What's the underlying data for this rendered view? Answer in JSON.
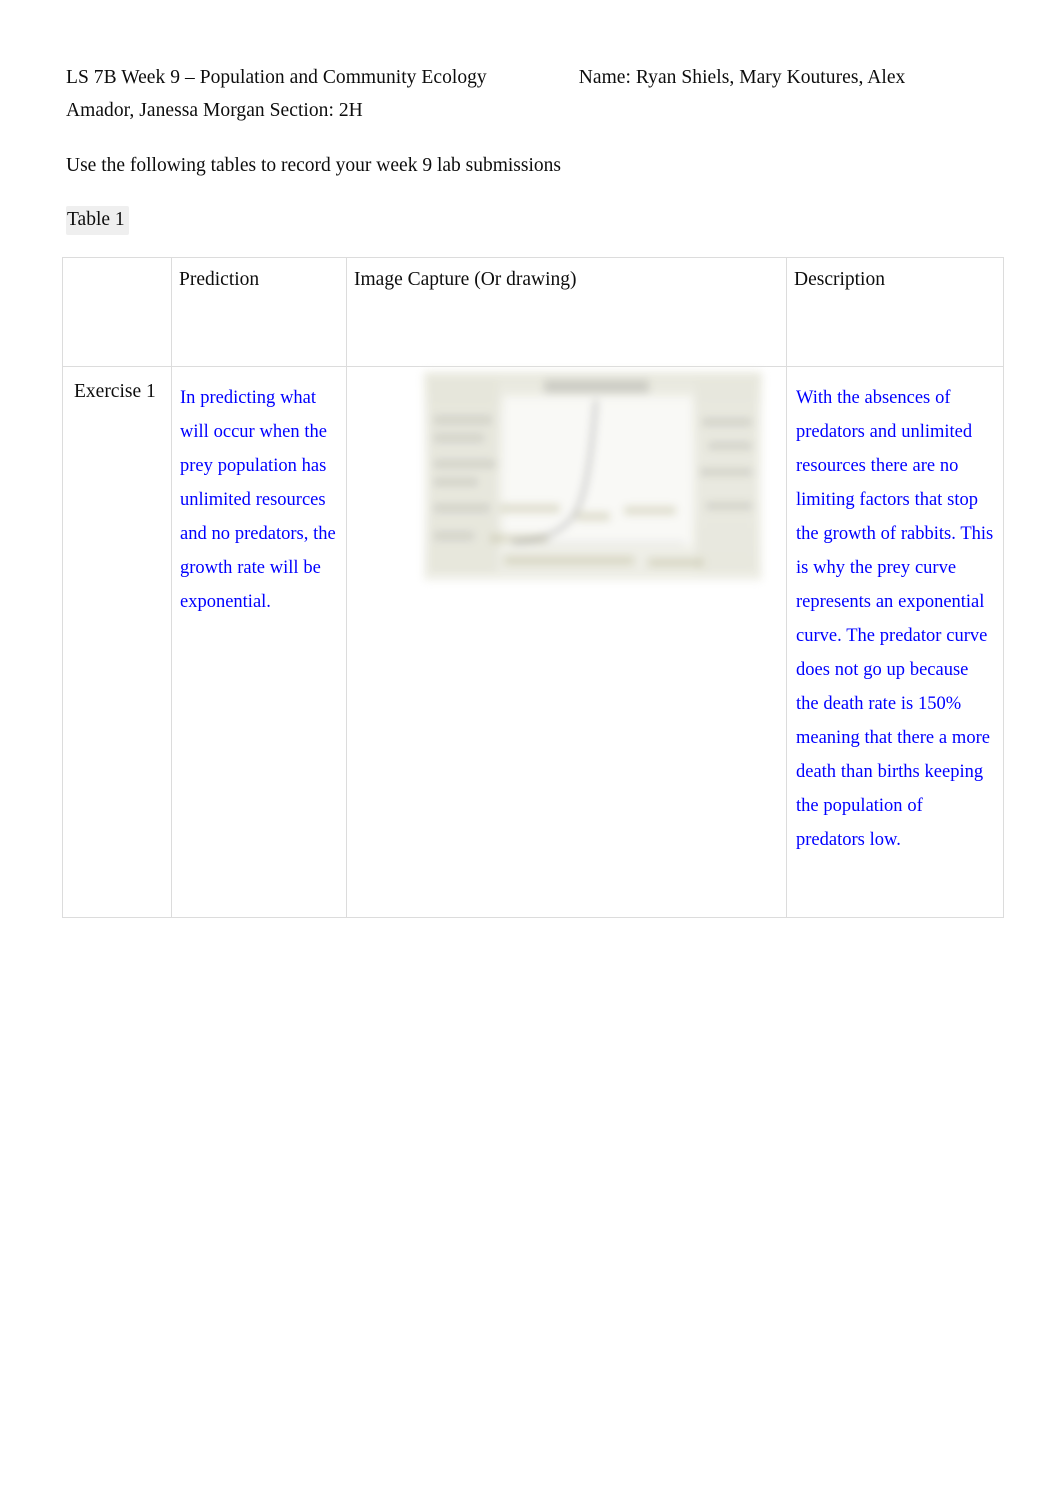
{
  "document": {
    "header": {
      "course_line": "LS 7B Week 9 – Population and Community Ecology",
      "name_line": "Name: Ryan Shiels, Mary Koutures, Alex",
      "second_line": "Amador, Janessa Morgan Section: 2H"
    },
    "instruction": "Use the following tables to record your week 9 lab submissions",
    "table_label": "Table 1"
  },
  "table": {
    "columns": [
      {
        "key": "row_label",
        "header": ""
      },
      {
        "key": "prediction",
        "header": "Prediction"
      },
      {
        "key": "image_capture",
        "header": "Image Capture (Or drawing)"
      },
      {
        "key": "description",
        "header": "Description"
      }
    ],
    "rows": [
      {
        "row_label": "Exercise 1",
        "prediction": "In predicting what will occur when the prey population has unlimited resources and no predators, the growth rate will be exponential.",
        "image_capture_alt": "blurred screenshot of population growth simulation showing an exponential prey curve",
        "description": "With the absences of predators and unlimited resources there are no limiting factors that stop the growth of rabbits. This is why the prey curve represents an exponential curve. The predator curve does not go up because the death rate is 150% meaning that there a more death than births keeping the population of predators low."
      }
    ]
  },
  "colors": {
    "answer_text": "#0000ff",
    "body_text": "#0d0d0d",
    "table_border": "#dcdcdc",
    "page_background": "#ffffff",
    "image_tint": "#e9e9df"
  }
}
